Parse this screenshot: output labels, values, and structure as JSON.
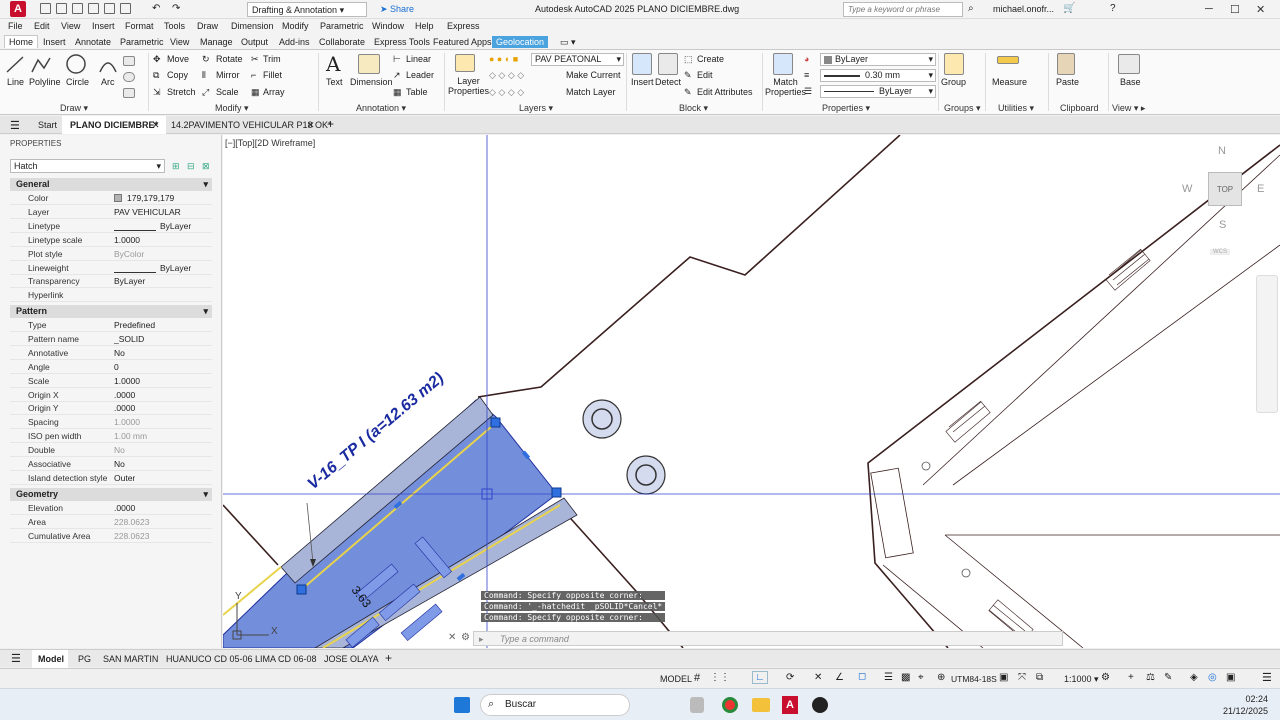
{
  "titlebar": {
    "workspace": "Drafting & Annotation",
    "share": "Share",
    "app_title": "Autodesk AutoCAD 2025   PLANO DICIEMBRE.dwg",
    "search_placeholder": "Type a keyword or phrase",
    "user": "michael.onofr..."
  },
  "menu": [
    "File",
    "Edit",
    "View",
    "Insert",
    "Format",
    "Tools",
    "Draw",
    "Dimension",
    "Modify",
    "Parametric",
    "Window",
    "Help",
    "Express"
  ],
  "ribbon_tabs": [
    "Home",
    "Insert",
    "Annotate",
    "Parametric",
    "View",
    "Manage",
    "Output",
    "Add-ins",
    "Collaborate",
    "Express Tools",
    "Featured Apps",
    "Geolocation"
  ],
  "ribbon": {
    "draw": {
      "line": "Line",
      "polyline": "Polyline",
      "circle": "Circle",
      "arc": "Arc",
      "panel": "Draw"
    },
    "modify": {
      "move": "Move",
      "rotate": "Rotate",
      "trim": "Trim",
      "copy": "Copy",
      "mirror": "Mirror",
      "fillet": "Fillet",
      "stretch": "Stretch",
      "scale": "Scale",
      "array": "Array",
      "panel": "Modify"
    },
    "annotation": {
      "text": "Text",
      "dimension": "Dimension",
      "linear": "Linear",
      "leader": "Leader",
      "table": "Table",
      "panel": "Annotation"
    },
    "layers": {
      "layer_properties": "Layer\nProperties",
      "current_layer": "PAV PEATONAL",
      "make_current": "Make Current",
      "match_layer": "Match Layer",
      "panel": "Layers"
    },
    "block": {
      "insert": "Insert",
      "detect": "Detect",
      "create": "Create",
      "edit": "Edit",
      "edit_attributes": "Edit Attributes",
      "panel": "Block"
    },
    "properties": {
      "match": "Match\nProperties",
      "color": "ByLayer",
      "lineweight": "0.30 mm",
      "linetype": "ByLayer",
      "panel": "Properties"
    },
    "groups": {
      "group": "Group",
      "panel": "Groups"
    },
    "utilities": {
      "measure": "Measure",
      "panel": "Utilities"
    },
    "clipboard": {
      "paste": "Paste",
      "panel": "Clipboard"
    },
    "view": {
      "base": "Base",
      "panel": "View"
    }
  },
  "doc_tabs": [
    "Start",
    "PLANO DICIEMBRE*",
    "14.2PAVIMENTO VEHICULAR P18 OK*"
  ],
  "properties": {
    "header": "PROPERTIES",
    "selection": "Hatch",
    "general_label": "General",
    "general": [
      [
        "Color",
        "179,179,179"
      ],
      [
        "Layer",
        "PAV VEHICULAR"
      ],
      [
        "Linetype",
        "ByLayer"
      ],
      [
        "Linetype scale",
        "1.0000"
      ],
      [
        "Plot style",
        "ByColor"
      ],
      [
        "Lineweight",
        "ByLayer"
      ],
      [
        "Transparency",
        "ByLayer"
      ],
      [
        "Hyperlink",
        ""
      ]
    ],
    "pattern_label": "Pattern",
    "pattern": [
      [
        "Type",
        "Predefined"
      ],
      [
        "Pattern name",
        "_SOLID"
      ],
      [
        "Annotative",
        "No"
      ],
      [
        "Angle",
        "0"
      ],
      [
        "Scale",
        "1.0000"
      ],
      [
        "Origin X",
        ".0000"
      ],
      [
        "Origin Y",
        ".0000"
      ],
      [
        "Spacing",
        "1.0000"
      ],
      [
        "ISO pen width",
        "1.00 mm"
      ],
      [
        "Double",
        "No"
      ],
      [
        "Associative",
        "No"
      ],
      [
        "Island detection style",
        "Outer"
      ]
    ],
    "geometry_label": "Geometry",
    "geometry": [
      [
        "Elevation",
        ".0000"
      ],
      [
        "Area",
        "228.0623"
      ],
      [
        "Cumulative Area",
        "228.0623"
      ]
    ]
  },
  "viewport": {
    "label": "[−][Top][2D Wireframe]",
    "annotation": "V-16_TP I (a=12.63 m2)",
    "dim_text": "3.63",
    "viewcube": {
      "top": "TOP",
      "n": "N",
      "s": "S",
      "e": "E",
      "w": "W",
      "wcs": "WCS"
    }
  },
  "command": {
    "history": [
      "Command: Specify opposite corner:",
      "Command: '_-hatchedit _pSOLID*Cancel*",
      "Command: Specify opposite corner:"
    ],
    "placeholder": "Type a command"
  },
  "layout_tabs": [
    "Model",
    "PG",
    "SAN MARTIN",
    "HUANUCO CD 05-06",
    "LIMA CD 06-08",
    "JOSE OLAYA"
  ],
  "status": {
    "model": "MODEL",
    "coord": "UTM84-18S",
    "scale": "1:1000"
  },
  "taskbar": {
    "search": "Buscar",
    "time": "02:24",
    "date": "21/12/2025"
  }
}
